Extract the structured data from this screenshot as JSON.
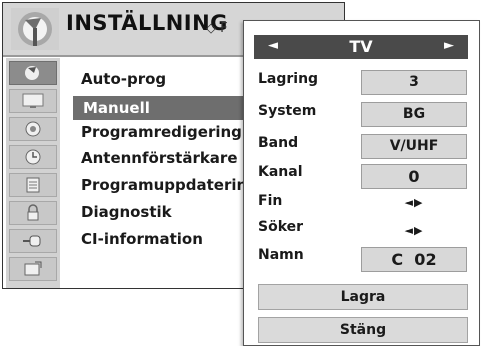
{
  "header": {
    "title": "INSTÄLLNING",
    "nav_hint": "◇ F"
  },
  "sidebar": {
    "icons": [
      {
        "name": "antenna-icon",
        "active": true
      },
      {
        "name": "picture-icon",
        "active": false
      },
      {
        "name": "audio-icon",
        "active": false
      },
      {
        "name": "clock-icon",
        "active": false
      },
      {
        "name": "option-icon",
        "active": false
      },
      {
        "name": "lock-icon",
        "active": false
      },
      {
        "name": "input-icon",
        "active": false
      },
      {
        "name": "usb-icon",
        "active": false
      }
    ]
  },
  "menu": {
    "items": [
      {
        "label": "Auto-prog"
      },
      {
        "label": "Manuell",
        "selected": true
      },
      {
        "label": "Programredigering"
      },
      {
        "label": "Antennförstärkare"
      },
      {
        "label": "Programuppdatering"
      },
      {
        "label": "Diagnostik"
      },
      {
        "label": "CI-information"
      }
    ]
  },
  "submenu": {
    "source": {
      "label": "TV",
      "left_arrow": "◄",
      "right_arrow": "►"
    },
    "rows": [
      {
        "label": "Lagring",
        "value": "3"
      },
      {
        "label": "System",
        "value": "BG"
      },
      {
        "label": "Band",
        "value": "V/UHF"
      },
      {
        "label": "Kanal",
        "value": "0"
      },
      {
        "label": "Fin",
        "value": "◄▶"
      },
      {
        "label": "Söker",
        "value": "◄▶"
      },
      {
        "label": "Namn",
        "value": "C  02"
      }
    ],
    "buttons": {
      "store": "Lagra",
      "close": "Stäng"
    }
  },
  "colors": {
    "header_bg": "#d6d6d6",
    "highlight_bg": "#6e6e6e",
    "tv_bar_bg": "#4a4a4a",
    "box_bg": "#d8d8d8"
  }
}
